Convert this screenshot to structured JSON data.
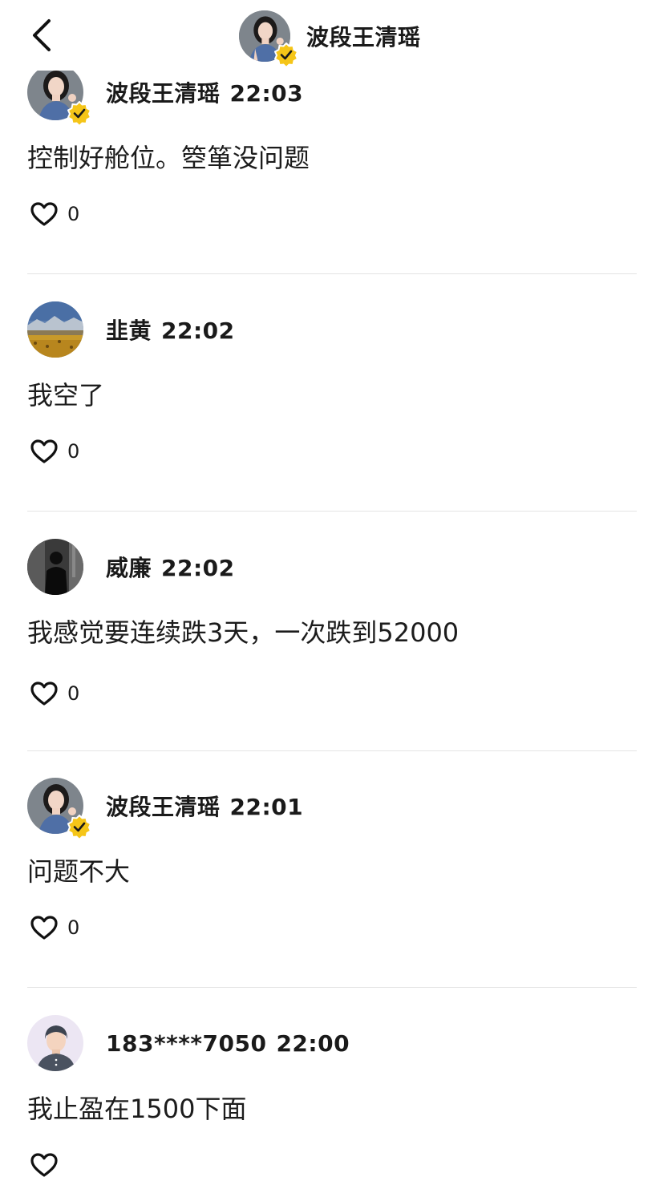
{
  "header": {
    "title": "波段王清瑶",
    "back_icon": "chevron-left-icon"
  },
  "comments": [
    {
      "author": "波段王清瑶",
      "time": "22:03",
      "text": "控制好舱位。箜箪没问题",
      "likes": "0",
      "verified": true,
      "avatar": "woman-avatar"
    },
    {
      "author": "韭黄",
      "time": "22:02",
      "text": "我空了",
      "likes": "0",
      "verified": false,
      "avatar": "landscape-avatar"
    },
    {
      "author": "威廉",
      "time": "22:02",
      "text": "我感觉要连续跌3天，一次跌到52000",
      "likes": "0",
      "verified": false,
      "avatar": "dark-figure-avatar"
    },
    {
      "author": "波段王清瑶",
      "time": "22:01",
      "text": "问题不大",
      "likes": "0",
      "verified": true,
      "avatar": "woman-avatar"
    },
    {
      "author": "183****7050",
      "time": "22:00",
      "text": "我止盈在1500下面",
      "likes": "",
      "verified": false,
      "avatar": "default-man-avatar"
    }
  ],
  "colors": {
    "verified_badge": "#f5c518",
    "divider": "#e4e4e4",
    "text": "#1a1a1a"
  }
}
